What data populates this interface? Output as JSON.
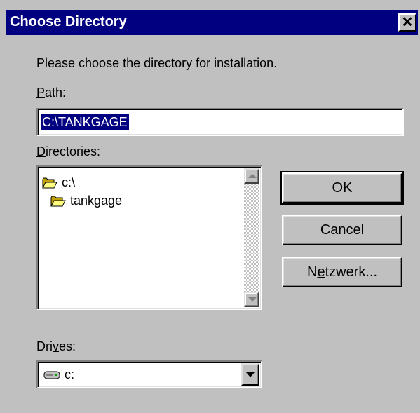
{
  "window": {
    "title": "Choose Directory",
    "close_glyph": "✕"
  },
  "prompt": "Please choose the directory for installation.",
  "path": {
    "label_ul": "P",
    "label_rest": "ath:",
    "value": "C:\\TANKGAGE"
  },
  "directories": {
    "label_ul": "D",
    "label_rest": "irectories:",
    "items": [
      {
        "label": "c:\\",
        "icon": "open-folder-icon"
      },
      {
        "label": "tankgage",
        "icon": "open-folder-icon"
      }
    ]
  },
  "buttons": {
    "ok": "OK",
    "cancel": "Cancel",
    "network_pre": "N",
    "network_ul": "e",
    "network_rest": "tzwerk..."
  },
  "drives": {
    "label_pre": "Dri",
    "label_ul": "v",
    "label_rest": "es:",
    "selected": "c:",
    "icon": "hard-drive-icon"
  },
  "colors": {
    "titlebar": "#000080",
    "face": "#c0c0c0",
    "selection": "#000080"
  }
}
